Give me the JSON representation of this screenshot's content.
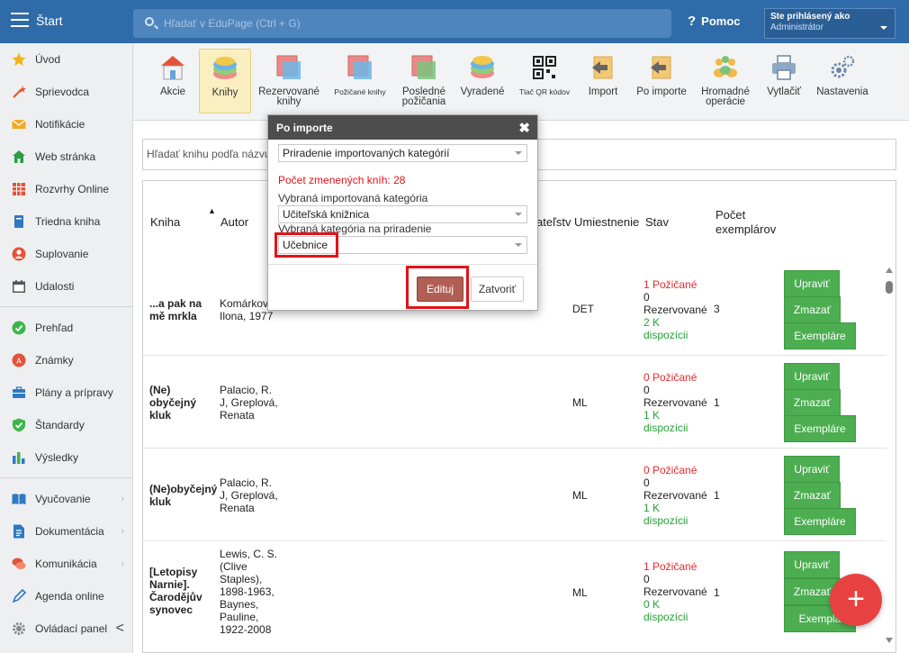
{
  "topbar": {
    "start_label": "Štart",
    "search_placeholder": "Hľadať v EduPage (Ctrl + G)",
    "help_label": "Pomoc",
    "user_line1": "Ste prihlásený ako",
    "user_line2": "Administrátor"
  },
  "sidebar": {
    "items": [
      {
        "label": "Úvod",
        "icon": "star-icon"
      },
      {
        "label": "Sprievodca",
        "icon": "wand-icon"
      },
      {
        "label": "Notifikácie",
        "icon": "envelope-icon"
      },
      {
        "label": "Web stránka",
        "icon": "house-icon"
      },
      {
        "label": "Rozvrhy Online",
        "icon": "timetable-icon"
      },
      {
        "label": "Triedna kniha",
        "icon": "book-icon"
      },
      {
        "label": "Suplovanie",
        "icon": "person-icon"
      },
      {
        "label": "Udalosti",
        "icon": "calendar-icon"
      },
      {
        "label": "Prehľad",
        "icon": "check-circle-icon"
      },
      {
        "label": "Známky",
        "icon": "grades-icon"
      },
      {
        "label": "Plány a prípravy",
        "icon": "briefcase-icon"
      },
      {
        "label": "Štandardy",
        "icon": "shield-check-icon"
      },
      {
        "label": "Výsledky",
        "icon": "bar-chart-icon"
      },
      {
        "label": "Vyučovanie",
        "icon": "open-book-icon"
      },
      {
        "label": "Dokumentácia",
        "icon": "document-icon"
      },
      {
        "label": "Komunikácia",
        "icon": "chat-icon"
      },
      {
        "label": "Agenda online",
        "icon": "pen-icon"
      },
      {
        "label": "Ovládací panel",
        "icon": "gear-icon"
      }
    ],
    "chevron": "›",
    "collapse": "<"
  },
  "toolbar": {
    "buttons": [
      {
        "label": "Akcie"
      },
      {
        "label": "Knihy"
      },
      {
        "label1": "Rezervované",
        "label2": "knihy"
      },
      {
        "label": "Požičané knihy"
      },
      {
        "label1": "Posledné",
        "label2": "požičania"
      },
      {
        "label": "Vyradené"
      },
      {
        "label": "Tlač QR kódov"
      },
      {
        "label": "Import"
      },
      {
        "label": "Po importe"
      },
      {
        "label1": "Hromadné",
        "label2": "operácie"
      },
      {
        "label": "Vytlačiť"
      },
      {
        "label": "Nastavenia"
      }
    ]
  },
  "filter": {
    "placeholder": "Hľadať knihu podľa názvu"
  },
  "table": {
    "headers": {
      "book": "Kniha",
      "author": "Autor",
      "publisher": "ateľstv",
      "location": "Umiestnenie",
      "status": "Stav",
      "count1": "Počet",
      "count2": "exemplárov",
      "sort_arrow": "▲"
    },
    "rows": [
      {
        "title": [
          "...a pak na",
          "mě mrkla"
        ],
        "author": [
          "Komárková",
          "Ilona, 1977"
        ],
        "location": "DET",
        "borrowed": "1 Požičané",
        "reserved_n": "0",
        "reserved": "Rezervované",
        "avail": "2 K",
        "avail2": "dispozícii",
        "count": "3"
      },
      {
        "title": [
          "(Ne)",
          "obyčejný",
          "kluk"
        ],
        "author": [
          "Palacio, R.",
          "J, Greplová,",
          "Renata"
        ],
        "location": "ML",
        "borrowed": "0 Požičané",
        "reserved_n": "0",
        "reserved": "Rezervované",
        "avail": "1 K",
        "avail2": "dispozícii",
        "count": "1"
      },
      {
        "title": [
          "(Ne)obyčejný",
          "kluk"
        ],
        "author": [
          "Palacio, R.",
          "J, Greplová,",
          "Renata"
        ],
        "location": "ML",
        "borrowed": "0 Požičané",
        "reserved_n": "0",
        "reserved": "Rezervované",
        "avail": "1 K",
        "avail2": "dispozícii",
        "count": "1"
      },
      {
        "title": [
          "[Letopisy",
          "Narnie].",
          "Čarodějův",
          "synovec"
        ],
        "author": [
          "Lewis, C. S.",
          "(Clive",
          "Staples),",
          "1898-1963,",
          "Baynes,",
          "Pauline,",
          "1922-2008"
        ],
        "location": "ML",
        "borrowed": "1 Požičané",
        "reserved_n": "0",
        "reserved": "Rezervované",
        "avail": "0 K",
        "avail2": "dispozícii",
        "count": "1"
      }
    ],
    "btn_edit": "Upraviť",
    "btn_delete": "Zmazať",
    "btn_copies": "Exempláre",
    "btn_copies_cut": "Exemplá"
  },
  "modal": {
    "title": "Po importe",
    "close_glyph": "✖",
    "select1": "Priradenie importovaných kategórií",
    "changed": "Počet zmenených kníh: 28",
    "label_imported": "Vybraná importovaná kategória",
    "select2": "Učiteľská knižnica",
    "label_assign": "Vybraná kategória na priradenie",
    "select3": "Učebnice",
    "edit_button": "Edituj",
    "close_button": "Zatvoriť"
  },
  "fab_label": "+",
  "colors": {
    "topbar": "#2f6ba8",
    "green": "#4cae50",
    "red": "#e32b2b",
    "highlight": "#e0131a",
    "edit": "#b15e54"
  }
}
